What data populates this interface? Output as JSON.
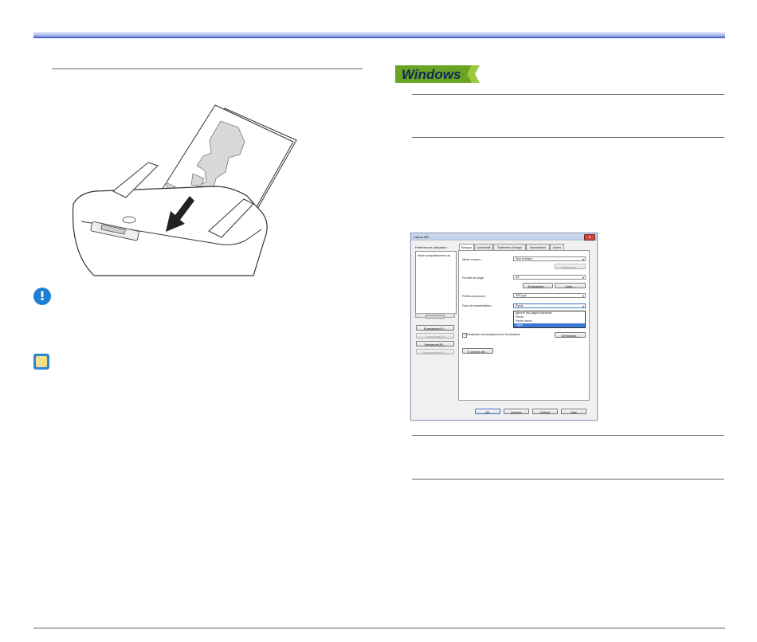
{
  "page": {
    "top_bar_color": "#2d4fbf",
    "windows_label": "Windows"
  },
  "dialog": {
    "title": "Canon DR-",
    "close_label": "x",
    "preferences_label": "Préférences utilisateur :",
    "preferences_item": "Mode compatissement au",
    "scroll_left": "‹",
    "scroll_thumb": "—",
    "scroll_right": "›",
    "buttons_left": [
      "Enregistrer(V)...",
      "Supprimer(D)",
      "Restaurer(R)...",
      "Sauvegarder(K)..."
    ],
    "tabs": [
      "Basique",
      "Luminosité",
      "Traitement d'image",
      "Alimentation",
      "Autres"
    ],
    "color_mode_label": "Mode couleur :",
    "color_mode_value": "Noir et blanc",
    "definitions_button_1": "Définitions...",
    "page_format_label": "Format de page :",
    "page_format_value": "A4",
    "save_button": "Enregistrer ...",
    "zone_button": "Zone...",
    "dpi_label": "Points par pouce :",
    "dpi_value": "300 ppp",
    "side_label": "Face de numérisation :",
    "side_value": "Recto",
    "dropdown_options": [
      "Ignorer les pages blanches",
      "Recto",
      "Recto-verso",
      "Ligne"
    ],
    "dropdown_highlight_index": 3,
    "auto_detect_label": "Redresse automatiquement l'inclinaison",
    "definitions_button_2": "Définitions...",
    "about_button": "À propos de...",
    "ok_button": "OK",
    "cancel_button": "Annuler",
    "default_button": "Défaut",
    "help_button": "Aide",
    "select_arrow": "▾",
    "checkmark": "✓"
  },
  "icons": {
    "caution": "!"
  }
}
